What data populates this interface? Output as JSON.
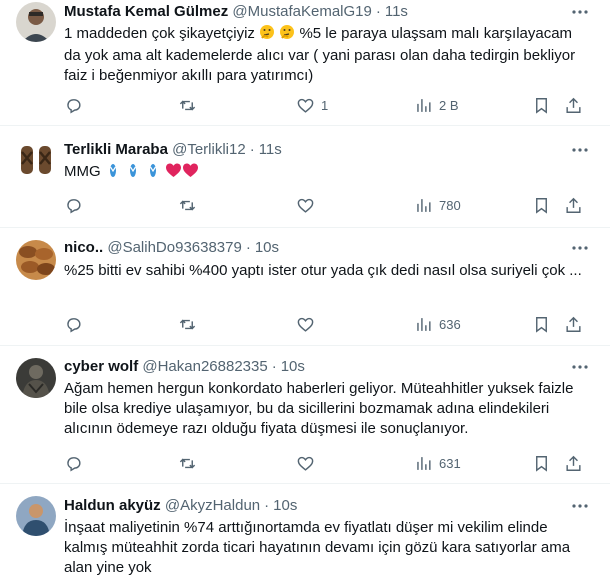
{
  "tweets": [
    {
      "name": "Mustafa Kemal Gülmez",
      "handle": "@MustafaKemalG19",
      "dot": "·",
      "time": "11s",
      "text_1": "1 maddeden çok şikayetçiyiz ",
      "text_2": " %5 le paraya ulaşsam malı karşılayacam da yok ama alt kademelerde alıcı var ( yani parası olan daha tedirgin bekliyor faiz i beğenmiyor akıllı para yatırımcı)",
      "likes": "1",
      "views": "2 B"
    },
    {
      "name": "Terlikli Maraba",
      "handle": "@Terlikli12",
      "dot": "·",
      "time": "11s",
      "text_1": "MMG",
      "views": "780"
    },
    {
      "name": "nico..",
      "handle": "@SalihDo93638379",
      "dot": "·",
      "time": "10s",
      "text_1": "%25 bitti ev sahibi %400 yaptı ister otur yada çık dedi nasıl olsa suriyeli çok ...",
      "views": "636"
    },
    {
      "name": "cyber wolf",
      "handle": "@Hakan26882335",
      "dot": "·",
      "time": "10s",
      "text_1": "Ağam hemen hergun konkordato haberleri geliyor. Müteahhitler yuksek faizle bile olsa krediye ulaşamıyor, bu da sicillerini bozmamak adına elindekileri alıcının ödemeye razı olduğu fiyata düşmesi ile sonuçlanıyor.",
      "views": "631"
    },
    {
      "name": "Haldun akyüz",
      "handle": "@AkyzHaldun",
      "dot": "·",
      "time": "10s",
      "text_1": "İnşaat maliyetinin %74 arttığınortamda ev fiyatlatı düşer mi vekilim elinde kalmış müteahhit zorda ticari hayatının devamı için gözü kara satıyorlar ama alan yine yok"
    }
  ],
  "icons": {
    "reply": "reply-icon",
    "retweet": "retweet-icon",
    "like": "heart-icon",
    "views": "views-icon",
    "bookmark": "bookmark-icon",
    "share": "share-icon",
    "more": "more-options-icon"
  },
  "colors": {
    "text": "#0f1419",
    "secondary": "#536471",
    "divider": "#eff3f4",
    "heart": "#e0245e",
    "flipflop": "#3b94d9"
  }
}
